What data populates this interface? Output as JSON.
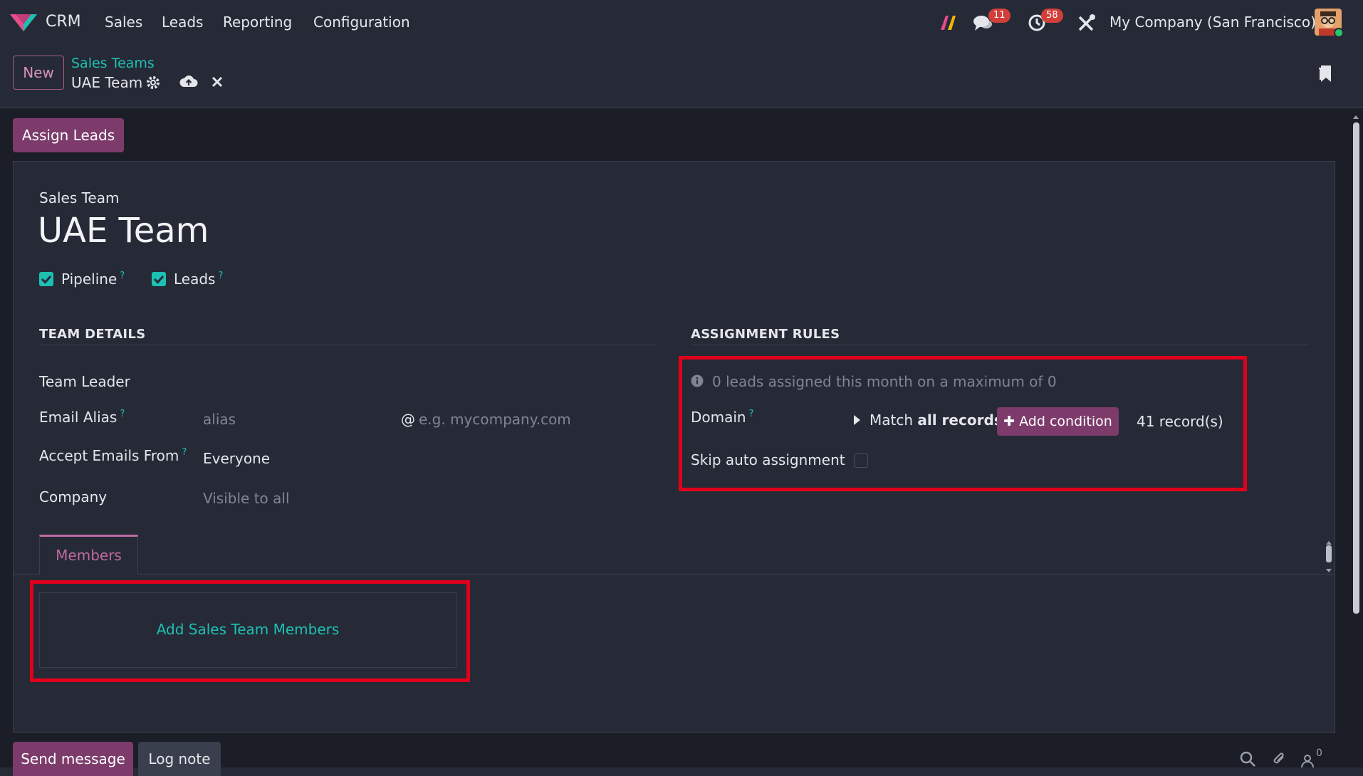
{
  "nav": {
    "app_name": "CRM",
    "menu": [
      "Sales",
      "Leads",
      "Reporting",
      "Configuration"
    ],
    "messages_count": "11",
    "activities_count": "58",
    "company": "My Company (San Francisco)"
  },
  "controlbar": {
    "new_label": "New",
    "breadcrumb_parent": "Sales Teams",
    "breadcrumb_current": "UAE Team"
  },
  "actions": {
    "assign_leads": "Assign Leads"
  },
  "form": {
    "title_label": "Sales Team",
    "title": "UAE Team",
    "pipeline_label": "Pipeline",
    "leads_label": "Leads",
    "q": "?",
    "team_details": {
      "heading": "TEAM DETAILS",
      "team_leader_label": "Team Leader",
      "email_alias_label": "Email Alias",
      "alias_placeholder": "alias",
      "at_sign": "@",
      "domain_placeholder": "e.g. mycompany.com",
      "accept_emails_label": "Accept Emails From",
      "accept_emails_value": "Everyone",
      "company_label": "Company",
      "company_placeholder": "Visible to all"
    },
    "assignment_rules": {
      "heading": "ASSIGNMENT RULES",
      "info_text": "0 leads assigned this month on a maximum of 0",
      "domain_label": "Domain",
      "match_prefix": "Match",
      "match_bold": "all records",
      "add_condition": "Add condition",
      "records_link": "41 record(s)",
      "skip_label": "Skip auto assignment"
    },
    "tabs": [
      "Members"
    ],
    "add_members": "Add Sales Team Members"
  },
  "chatter": {
    "send_message": "Send message",
    "log_note": "Log note",
    "followers_count": "0"
  },
  "colors": {
    "accent": "#7c3b6b",
    "link": "#1ec0b4",
    "highlight": "#e0001b"
  }
}
